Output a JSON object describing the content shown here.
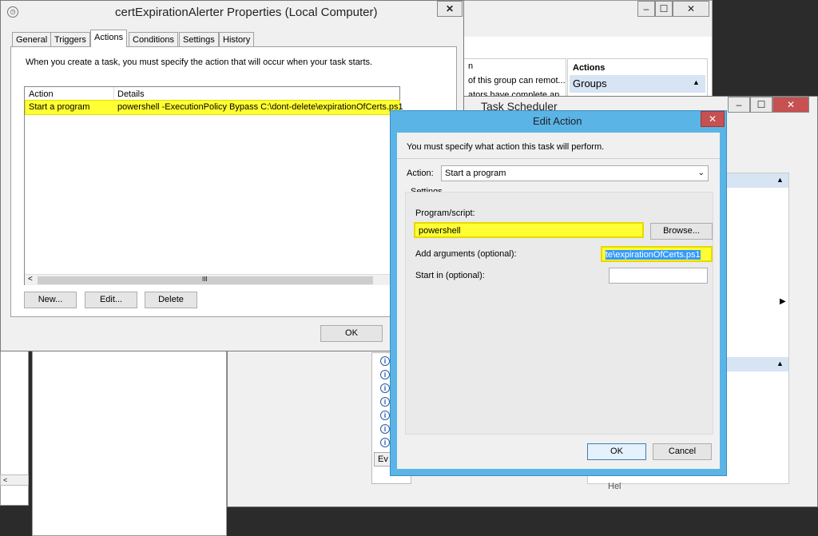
{
  "props_window": {
    "title": "certExpirationAlerter Properties (Local Computer)",
    "close_glyph": "✕",
    "tabs": [
      {
        "label": "General"
      },
      {
        "label": "Triggers"
      },
      {
        "label": "Actions"
      },
      {
        "label": "Conditions"
      },
      {
        "label": "Settings"
      },
      {
        "label": "History"
      }
    ],
    "instruction": "When you create a task, you must specify the action that will occur when your task starts.",
    "table": {
      "headers": [
        "Action",
        "Details"
      ],
      "rows": [
        {
          "action": "Start a program",
          "details": "powershell -ExecutionPolicy Bypass C:\\dont-delete\\expirationOfCerts.ps1"
        }
      ],
      "scroll_left": "<",
      "scroll_mid": "III",
      "scroll_right": ">"
    },
    "buttons": {
      "new": "New...",
      "edit": "Edit...",
      "delete": "Delete",
      "ok": "OK"
    }
  },
  "background_window": {
    "snippets": [
      "n",
      "of this group can remot...",
      "ators have complete an..."
    ],
    "actions_header": "Actions",
    "groups_label": "Groups",
    "bottom_tab": "Ev"
  },
  "task_scheduler": {
    "title": "Task Scheduler",
    "bottom_text": "Hel"
  },
  "edit_action": {
    "title": "Edit Action",
    "close_glyph": "✕",
    "instruction": "You must specify what action this task will perform.",
    "action_label": "Action:",
    "action_value": "Start a program",
    "settings_label": "Settings",
    "program_label": "Program/script:",
    "program_value": "powershell",
    "browse": "Browse...",
    "args_label": "Add arguments (optional):",
    "args_value": "te\\expirationOfCerts.ps1",
    "startin_label": "Start in (optional):",
    "startin_value": "",
    "ok": "OK",
    "cancel": "Cancel"
  },
  "colors": {
    "highlight": "#ffff33",
    "dialog_frame": "#5ab4e6",
    "close_red": "#c75050",
    "desktop": "#2b2b2b"
  },
  "icons": [
    "clock-icon",
    "info-icon",
    "chevron-down-icon",
    "chevron-up-icon",
    "close-icon",
    "minimize-icon",
    "maximize-icon"
  ]
}
